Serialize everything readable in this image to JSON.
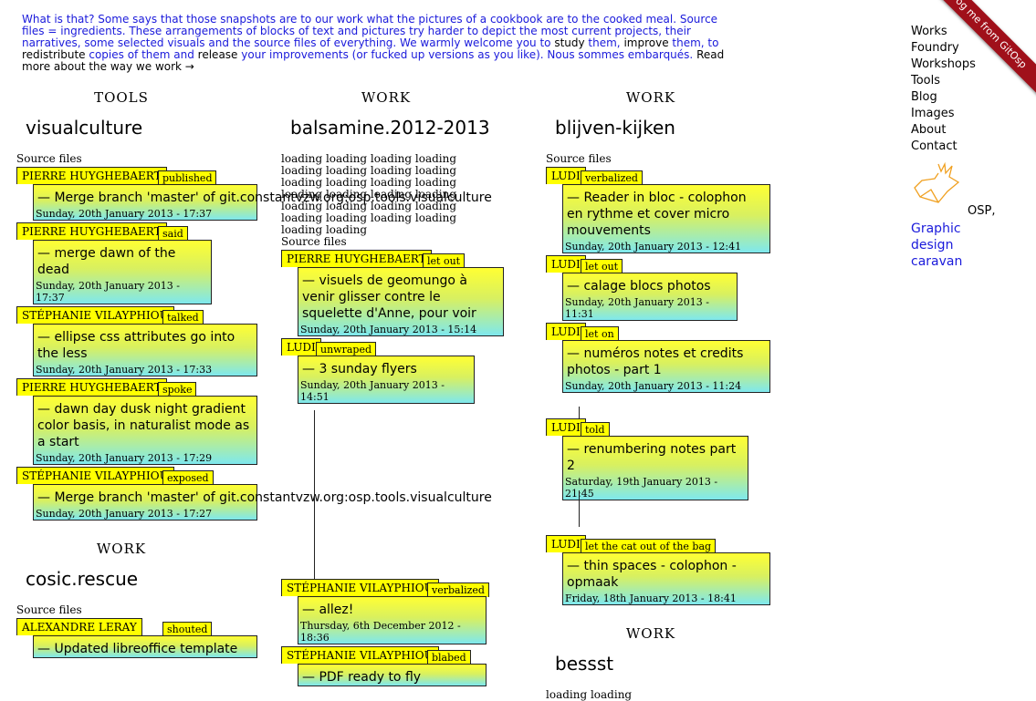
{
  "intro": {
    "p1": "What is that? Some says that those snapshots are to our work what the pictures of a cookbook are to the cooked meal. Source files = ingredients. These arrangements of blocks of text and pictures try harder to depict the most current projects, their narratives, some selected visuals and the source files of everything. We warmly welcome you to ",
    "study": "study",
    "them1": " them, ",
    "improve": "improve",
    "them2": " them, to ",
    "redistribute": "redistribute",
    "copies": " copies of them and ",
    "release": "release",
    "p2": " your improvements (or fucked up versions as you like). Nous sommes embarqués. ",
    "readmore": "Read more about the way we work →"
  },
  "columns": [
    {
      "kicker": "TOOLS",
      "title": "visualculture",
      "source": "Source files",
      "commits": [
        {
          "author": "PIERRE HUYGHEBAERT",
          "verb": "published",
          "msg": "— Merge branch 'master' of git.constantvzw.org:osp.tools.visualculture",
          "date": "Sunday, 20th January 2013 - 17:37"
        },
        {
          "author": "PIERRE HUYGHEBAERT",
          "verb": "said",
          "msg": "— merge dawn of the dead",
          "date": "Sunday, 20th January 2013 - 17:37"
        },
        {
          "author": "STÉPHANIE VILAYPHIOU",
          "verb": "talked",
          "msg": "— ellipse css attributes go into the less",
          "date": "Sunday, 20th January 2013 - 17:33"
        },
        {
          "author": "PIERRE HUYGHEBAERT",
          "verb": "spoke",
          "msg": "— dawn day dusk night gradient color basis, in naturalist mode as a start",
          "date": "Sunday, 20th January 2013 - 17:29"
        },
        {
          "author": "STÉPHANIE VILAYPHIOU",
          "verb": "exposed",
          "msg": "— Merge branch 'master' of git.constantvzw.org:osp.tools.visualculture",
          "date": "Sunday, 20th January 2013 - 17:27"
        }
      ]
    },
    {
      "kicker": "WORK",
      "title": "balsamine.2012-2013",
      "loading": "loading loading loading loading loading loading loading loading loading loading loading loading loading loading loading loading loading loading loading loading loading loading loading loading loading loading",
      "source": "Source files",
      "commits": [
        {
          "author": "PIERRE HUYGHEBAERT",
          "verb": "let out",
          "msg": "— visuels de geomungo à venir glisser contre le squelette d'Anne, pour voir",
          "date": "Sunday, 20th January 2013 - 15:14"
        },
        {
          "author": "LUDI",
          "verb": "unwraped",
          "msg": "— 3 sunday flyers",
          "date": "Sunday, 20th January 2013 - 14:51"
        },
        {
          "author": "STÉPHANIE VILAYPHIOU",
          "verb": "verbalized",
          "msg": "— allez!",
          "date": "Thursday, 6th December 2012 - 18:36"
        },
        {
          "author": "STÉPHANIE VILAYPHIOU",
          "verb": "blabed",
          "msg": "— PDF ready to fly",
          "date": ""
        }
      ]
    },
    {
      "kicker": "WORK",
      "title": "blijven-kijken",
      "source": "Source files",
      "commits": [
        {
          "author": "LUDI",
          "verb": "verbalized",
          "msg": "— Reader in bloc - colophon en rythme et cover micro mouvements",
          "date": "Sunday, 20th January 2013 - 12:41"
        },
        {
          "author": "LUDI",
          "verb": "let out",
          "msg": "— calage blocs photos",
          "date": "Sunday, 20th January 2013 - 11:31"
        },
        {
          "author": "LUDI",
          "verb": "let on",
          "msg": "— numéros notes et credits photos - part 1",
          "date": "Sunday, 20th January 2013 - 11:24"
        },
        {
          "author": "LUDI",
          "verb": "told",
          "msg": "— renumbering notes part 2",
          "date": "Saturday, 19th January 2013 - 21:45"
        },
        {
          "author": "LUDI",
          "verb": "let the cat out of the bag",
          "msg": "— thin spaces - colophon - opmaak",
          "date": "Friday, 18th January 2013 - 18:41"
        }
      ]
    }
  ],
  "col1b": {
    "kicker": "WORK",
    "title": "cosic.rescue",
    "source": "Source files",
    "commits": [
      {
        "author": "ALEXANDRE LERAY",
        "verb": "shouted",
        "msg": "— Updated libreoffice template",
        "date": ""
      }
    ]
  },
  "col3b": {
    "kicker": "WORK",
    "title": "bessst",
    "loading": "loading loading"
  },
  "nav": [
    "Works",
    "Foundry",
    "Workshops",
    "Tools",
    "Blog",
    "Images",
    "About",
    "Contact"
  ],
  "osp": {
    "label": "OSP,",
    "tagline": "Graphic design caravan"
  },
  "ribbon": "Frog me from GitOsp"
}
